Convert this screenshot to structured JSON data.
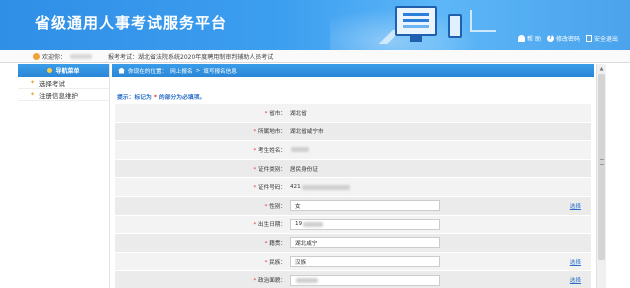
{
  "header": {
    "title": "省级通用人事考试服务平台",
    "links": {
      "help": "帮 助",
      "change_password": "修改密码",
      "logout": "安全退出"
    }
  },
  "infobar": {
    "welcome_label": "欢迎你：",
    "exam_label": "报考考试：",
    "exam_name": "湖北省法院系统2020年度聘用制审判辅助人员考试"
  },
  "sidebar": {
    "head": "导航菜单",
    "items": [
      {
        "label": "选择考试"
      },
      {
        "label": "注册信息维护"
      }
    ]
  },
  "breadcrumb": {
    "prefix": "你现在的位置：",
    "level1": "网上报名",
    "sep": ">",
    "level2": "填写报名信息"
  },
  "tip": {
    "prefix": "提示：标记为",
    "star": "*",
    "suffix": "的部分为必填项。"
  },
  "form": {
    "rows": [
      {
        "label": "省市：",
        "value": "湖北省"
      },
      {
        "label": "所属地市：",
        "value": "湖北省咸宁市"
      },
      {
        "label": "考生姓名：",
        "value": ""
      },
      {
        "label": "证件类别：",
        "value": "居民身份证"
      },
      {
        "label": "证件号码：",
        "value": "421"
      },
      {
        "label": "性别：",
        "value": "女",
        "action": "选择"
      },
      {
        "label": "出生日期：",
        "value": "19"
      },
      {
        "label": "籍贯：",
        "value": "湖北咸宁"
      },
      {
        "label": "民族：",
        "value": "汉族",
        "action": "选择"
      },
      {
        "label": "政治面貌：",
        "value": "",
        "action": "选择"
      }
    ]
  }
}
